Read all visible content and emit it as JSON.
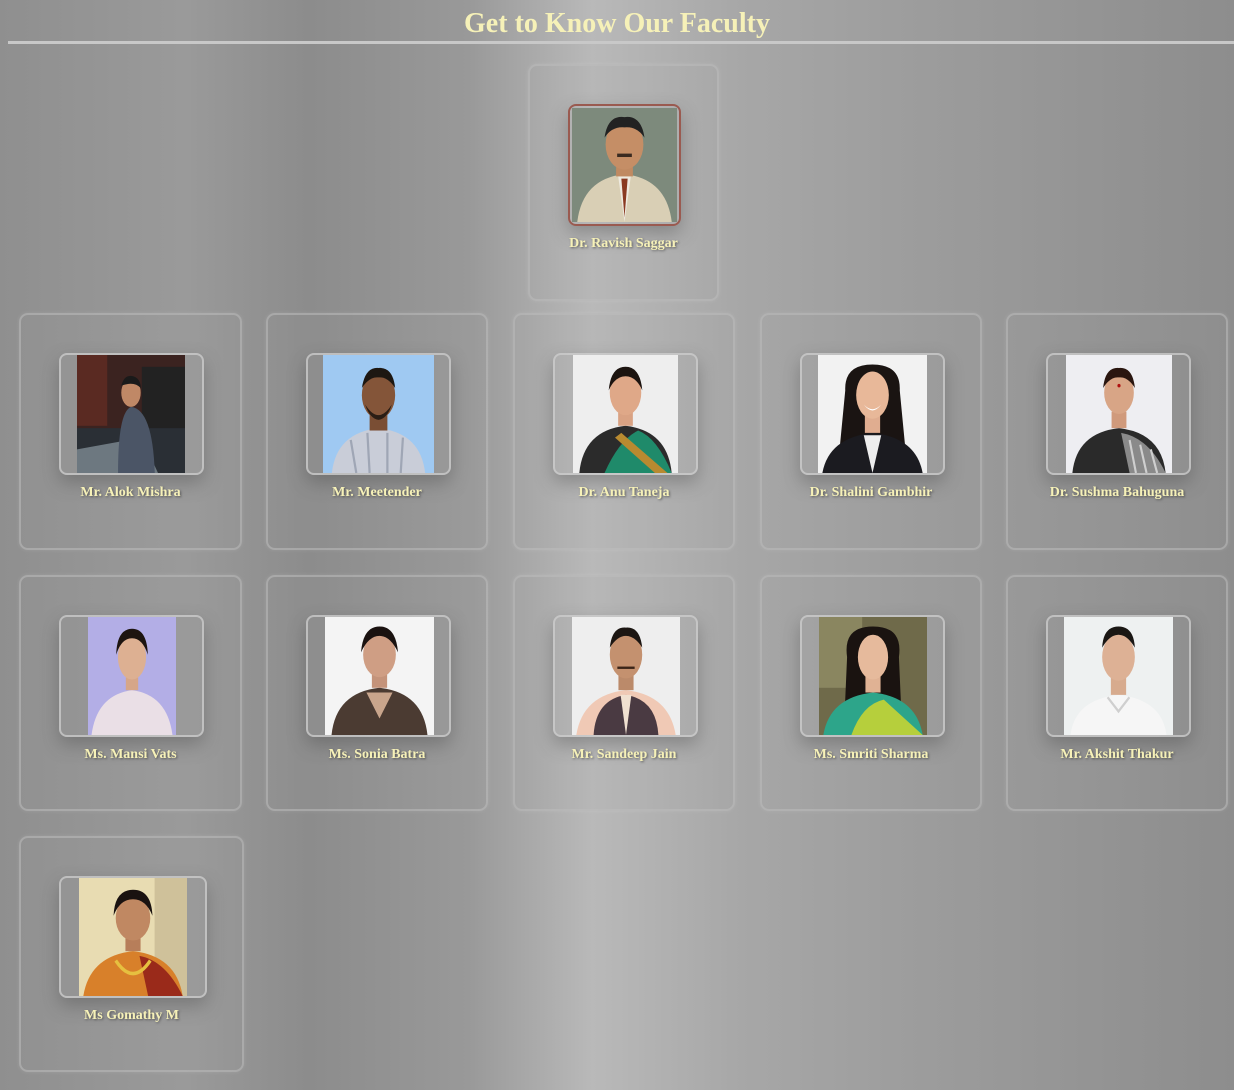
{
  "page": {
    "title": "Get to Know Our Faculty"
  },
  "faculty": [
    {
      "name": "Dr. Ravish Saggar"
    },
    {
      "name": "Mr. Alok Mishra"
    },
    {
      "name": "Mr. Meetender"
    },
    {
      "name": "Dr. Anu Taneja"
    },
    {
      "name": "Dr. Shalini Gambhir"
    },
    {
      "name": "Dr. Sushma Bahuguna"
    },
    {
      "name": "Ms. Mansi Vats"
    },
    {
      "name": "Ms. Sonia Batra"
    },
    {
      "name": "Mr. Sandeep Jain"
    },
    {
      "name": "Ms. Smriti Sharma"
    },
    {
      "name": "Mr. Akshit Thakur"
    },
    {
      "name": "Ms Gomathy M"
    }
  ],
  "colors": {
    "title_text": "#f6f1b8",
    "name_text": "#f6f1b8",
    "rule": "#c8c8c8"
  }
}
